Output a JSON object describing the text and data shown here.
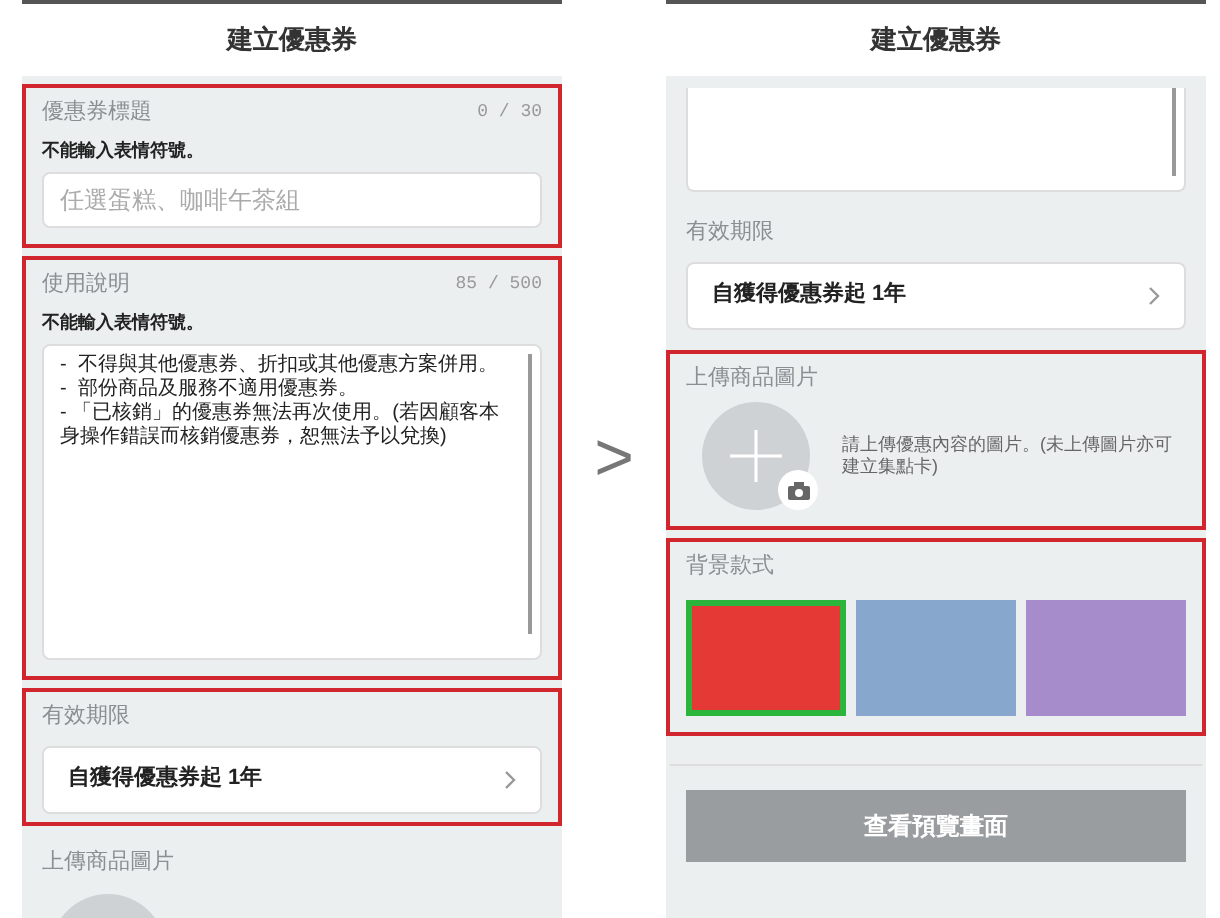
{
  "screens": [
    {
      "header": "建立優惠券",
      "sections": [
        {
          "kind": "text_input",
          "highlighted": true,
          "label": "優惠券標題",
          "counter": "0 / 30",
          "hint": "不能輸入表情符號。",
          "placeholder": "任選蛋糕、咖啡午茶組"
        },
        {
          "kind": "textarea",
          "highlighted": true,
          "label": "使用說明",
          "counter": "85 / 500",
          "hint": "不能輸入表情符號。",
          "value": "-  不得與其他優惠券、折扣或其他優惠方案併用。\n-  部份商品及服務不適用優惠券。\n- 「已核銷」的優惠券無法再次使用。(若因顧客本身操作錯誤而核銷優惠券，恕無法予以兌換)"
        },
        {
          "kind": "select",
          "highlighted": true,
          "label": "有效期限",
          "value": "自獲得優惠券起  1年"
        },
        {
          "kind": "upload_partial",
          "highlighted": false,
          "label": "上傳商品圖片"
        }
      ]
    },
    {
      "header": "建立優惠券",
      "sections": [
        {
          "kind": "textarea_tail",
          "highlighted": false
        },
        {
          "kind": "select",
          "highlighted": false,
          "label": "有效期限",
          "value": "自獲得優惠券起  1年"
        },
        {
          "kind": "upload",
          "highlighted": true,
          "label": "上傳商品圖片",
          "note": "請上傳優惠內容的圖片。(未上傳圖片亦可建立集點卡)"
        },
        {
          "kind": "backgrounds",
          "highlighted": true,
          "label": "背景款式",
          "options": [
            {
              "color": "#e53935",
              "selected": true
            },
            {
              "color": "#87a7cc",
              "selected": false
            },
            {
              "color": "#a78ccb",
              "selected": false
            }
          ]
        },
        {
          "kind": "button",
          "highlighted": false,
          "label": "查看預覽畫面"
        }
      ]
    }
  ],
  "separator": ">"
}
